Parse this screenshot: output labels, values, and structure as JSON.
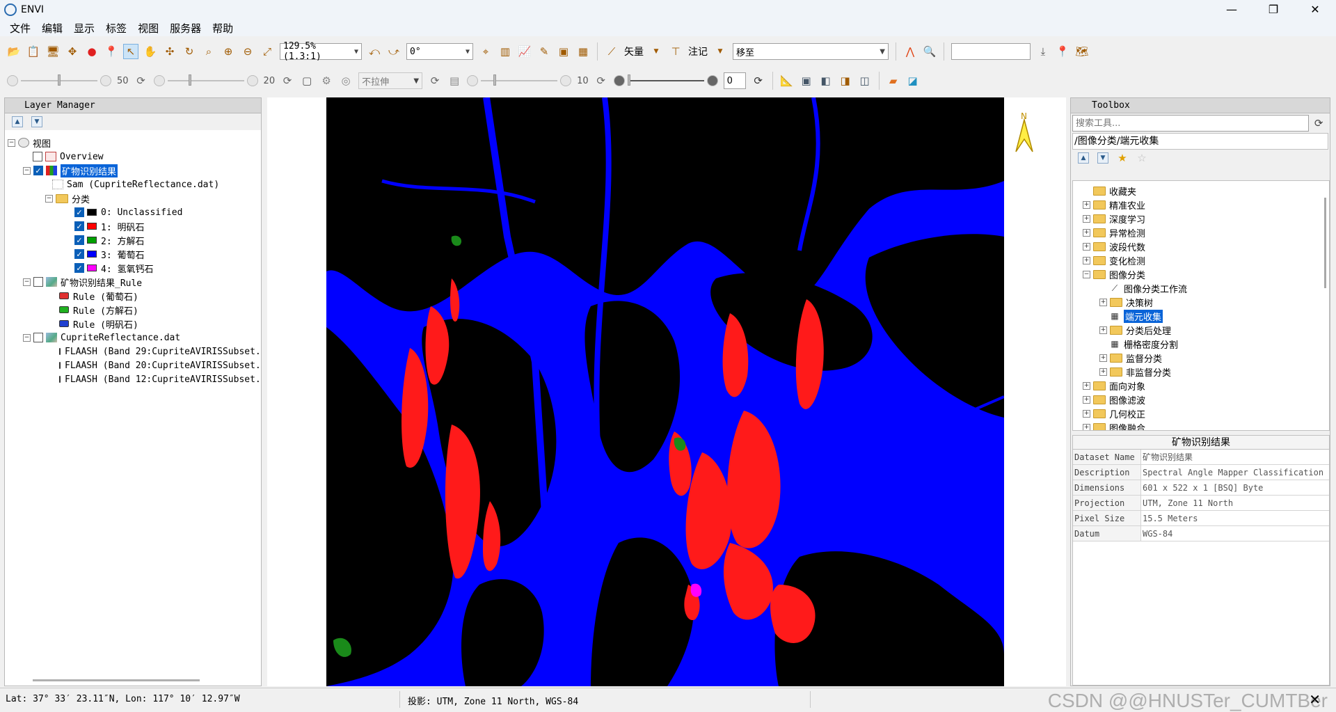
{
  "window": {
    "title": "ENVI",
    "minimize": "—",
    "maximize": "❐",
    "close": "✕"
  },
  "menu": [
    "文件",
    "编辑",
    "显示",
    "标签",
    "视图",
    "服务器",
    "帮助"
  ],
  "toolbar": {
    "zoom_value": "129.5% (1.3:1)",
    "rotation_value": "0°",
    "vector_label": "矢量",
    "annotation_label": "注记",
    "goto_value": "移至",
    "search_value": ""
  },
  "toolbar2": {
    "brightness_value": "50",
    "contrast_value": "20",
    "stretch_value": "不拉伸",
    "sharpen_value": "10",
    "transparency_value": "0"
  },
  "layer_manager": {
    "title": "Layer Manager",
    "root": "视图",
    "overview": "Overview",
    "result_layer": "矿物识别结果",
    "sam_source": "Sam (CupriteReflectance.dat)",
    "class_folder": "分类",
    "classes": [
      {
        "label": "0: Unclassified",
        "color": "#000000"
      },
      {
        "label": "1: 明矾石",
        "color": "#ff0000"
      },
      {
        "label": "2: 方解石",
        "color": "#00a000"
      },
      {
        "label": "3: 葡萄石",
        "color": "#0000ff"
      },
      {
        "label": "4: 氢氧钙石",
        "color": "#ff00ff"
      }
    ],
    "rule_layer": "矿物识别结果_Rule",
    "rules": [
      {
        "label": "Rule (葡萄石)",
        "color": "#e03030"
      },
      {
        "label": "Rule (方解石)",
        "color": "#20b020"
      },
      {
        "label": "Rule (明矾石)",
        "color": "#2040d0"
      }
    ],
    "reflectance_layer": "CupriteReflectance.dat",
    "bands": [
      {
        "label": "FLAASH (Band 29:CupriteAVIRISSubset.",
        "color": "#e03030"
      },
      {
        "label": "FLAASH (Band 20:CupriteAVIRISSubset.",
        "color": "#20b020"
      },
      {
        "label": "FLAASH (Band 12:CupriteAVIRISSubset.",
        "color": "#2040d0"
      }
    ]
  },
  "toolbox": {
    "title": "Toolbox",
    "search_placeholder": "搜索工具...",
    "path": "/图像分类/端元收集",
    "items": [
      {
        "label": "收藏夹",
        "level": 0,
        "type": "folder",
        "exp": ""
      },
      {
        "label": "精准农业",
        "level": 0,
        "type": "folder",
        "exp": "+"
      },
      {
        "label": "深度学习",
        "level": 0,
        "type": "folder",
        "exp": "+"
      },
      {
        "label": "异常检测",
        "level": 0,
        "type": "folder",
        "exp": "+"
      },
      {
        "label": "波段代数",
        "level": 0,
        "type": "folder",
        "exp": "+"
      },
      {
        "label": "变化检测",
        "level": 0,
        "type": "folder",
        "exp": "+"
      },
      {
        "label": "图像分类",
        "level": 0,
        "type": "folder",
        "exp": "−"
      },
      {
        "label": "图像分类工作流",
        "level": 1,
        "type": "wand",
        "exp": ""
      },
      {
        "label": "决策树",
        "level": 1,
        "type": "folder",
        "exp": "+"
      },
      {
        "label": "端元收集",
        "level": 1,
        "type": "tool",
        "exp": "",
        "selected": true
      },
      {
        "label": "分类后处理",
        "level": 1,
        "type": "folder",
        "exp": "+"
      },
      {
        "label": "栅格密度分割",
        "level": 1,
        "type": "tool",
        "exp": ""
      },
      {
        "label": "监督分类",
        "level": 1,
        "type": "folder",
        "exp": "+"
      },
      {
        "label": "非监督分类",
        "level": 1,
        "type": "folder",
        "exp": "+"
      },
      {
        "label": "面向对象",
        "level": 0,
        "type": "folder",
        "exp": "+"
      },
      {
        "label": "图像滤波",
        "level": 0,
        "type": "folder",
        "exp": "+"
      },
      {
        "label": "几何校正",
        "level": 0,
        "type": "folder",
        "exp": "+"
      },
      {
        "label": "图像融合",
        "level": 0,
        "type": "folder",
        "exp": "+"
      }
    ]
  },
  "properties": {
    "title": "矿物识别结果",
    "rows": [
      {
        "key": "Dataset Name",
        "value": "矿物识别结果"
      },
      {
        "key": "Description",
        "value": "Spectral Angle Mapper Classification"
      },
      {
        "key": "Dimensions",
        "value": "601 x 522 x 1 [BSQ] Byte"
      },
      {
        "key": "Projection",
        "value": "UTM, Zone 11 North"
      },
      {
        "key": "Pixel Size",
        "value": "15.5 Meters"
      },
      {
        "key": "Datum",
        "value": "WGS-84"
      }
    ]
  },
  "status": {
    "latlon": "Lat: 37° 33′ 23.11″N, Lon: 117° 10′ 12.97″W",
    "projection": "投影:  UTM, Zone 11 North, WGS-84",
    "watermark": "CSDN @@HNUSTer_CUMTBer"
  },
  "north_label": "N"
}
